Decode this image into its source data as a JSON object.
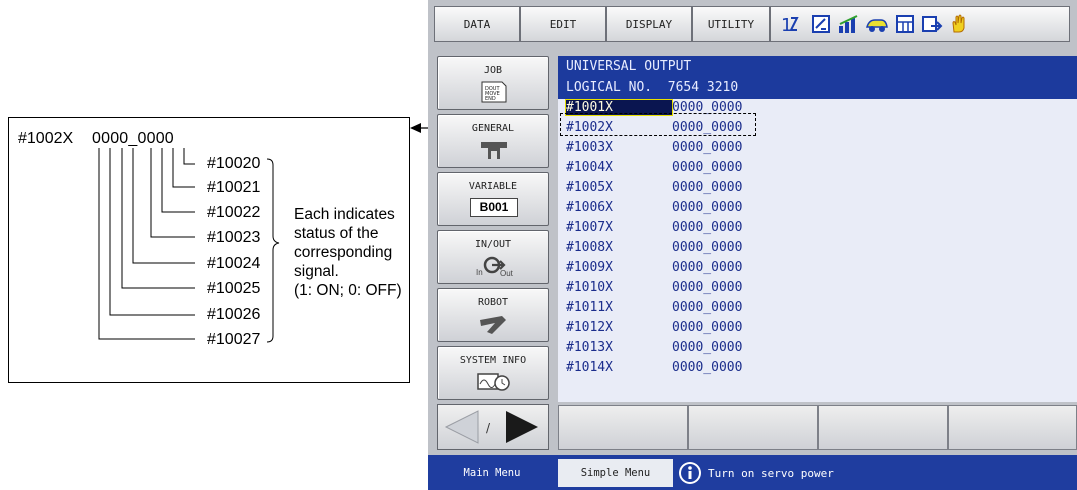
{
  "callout": {
    "address": "#1002X",
    "value": "0000_0000",
    "bits": [
      "#10020",
      "#10021",
      "#10022",
      "#10023",
      "#10024",
      "#10025",
      "#10026",
      "#10027"
    ],
    "note_lines": [
      "Each indicates",
      "status of the",
      "corresponding",
      "signal.",
      "(1: ON; 0: OFF)"
    ]
  },
  "top_tabs": [
    "DATA",
    "EDIT",
    "DISPLAY",
    "UTILITY"
  ],
  "toolbar_icons": [
    "io-toggle-icon",
    "edit-box-icon",
    "signal-icon",
    "car-icon",
    "grid-icon",
    "export-icon",
    "hand-icon"
  ],
  "side_menu": [
    {
      "label": "JOB",
      "icon": "job-document-icon",
      "icon_text": "DOUT MOVE END"
    },
    {
      "label": "GENERAL",
      "icon": "general-tool-icon"
    },
    {
      "label": "VARIABLE",
      "icon": "variable-icon",
      "icon_text": "B001"
    },
    {
      "label": "IN/OUT",
      "icon": "in-out-icon",
      "icon_in": "In",
      "icon_out": "Out"
    },
    {
      "label": "ROBOT",
      "icon": "robot-arm-icon"
    },
    {
      "label": "SYSTEM INFO",
      "icon": "system-info-icon"
    }
  ],
  "screen": {
    "title": "UNIVERSAL OUTPUT",
    "logical_label": "LOGICAL NO.",
    "logical_nums": "7654 3210",
    "rows": [
      {
        "addr": "#1001X",
        "value": "0000_0000"
      },
      {
        "addr": "#1002X",
        "value": "0000_0000"
      },
      {
        "addr": "#1003X",
        "value": "0000_0000"
      },
      {
        "addr": "#1004X",
        "value": "0000_0000"
      },
      {
        "addr": "#1005X",
        "value": "0000_0000"
      },
      {
        "addr": "#1006X",
        "value": "0000_0000"
      },
      {
        "addr": "#1007X",
        "value": "0000_0000"
      },
      {
        "addr": "#1008X",
        "value": "0000_0000"
      },
      {
        "addr": "#1009X",
        "value": "0000_0000"
      },
      {
        "addr": "#1010X",
        "value": "0000_0000"
      },
      {
        "addr": "#1011X",
        "value": "0000_0000"
      },
      {
        "addr": "#1012X",
        "value": "0000_0000"
      },
      {
        "addr": "#1013X",
        "value": "0000_0000"
      },
      {
        "addr": "#1014X",
        "value": "0000_0000"
      }
    ]
  },
  "status": {
    "main_menu": "Main Menu",
    "simple_menu": "Simple Menu",
    "message": "Turn on servo power"
  },
  "colors": {
    "screen_header": "#1c3a9d",
    "row_text": "#1b2d8c",
    "status_bar": "#1f3d9f"
  }
}
